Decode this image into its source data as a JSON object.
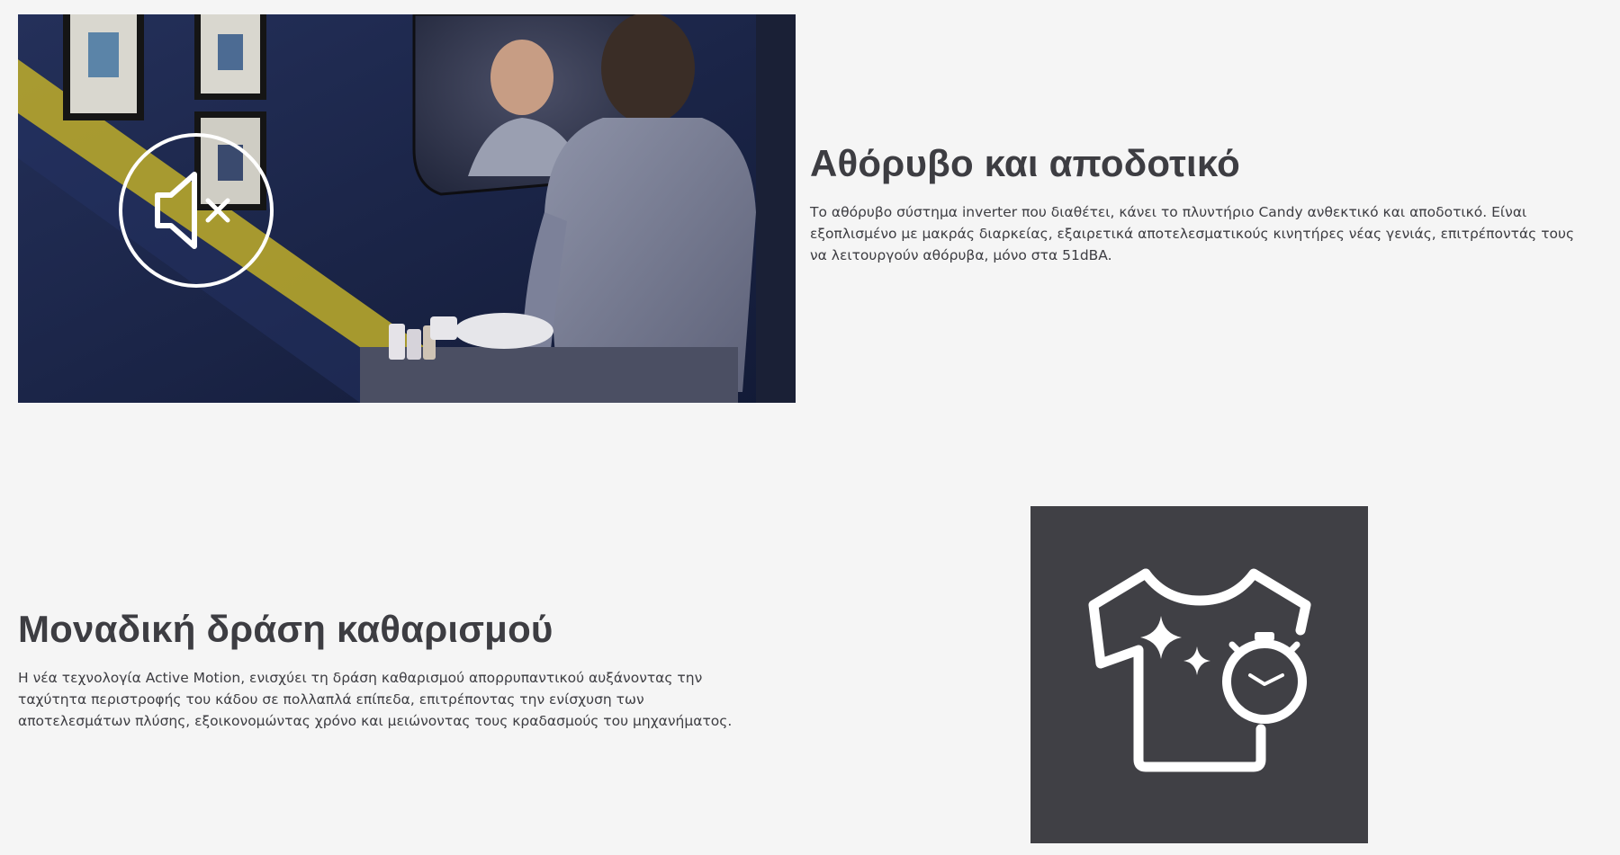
{
  "features": [
    {
      "title": "Αθόρυβο και αποδοτικό",
      "description": "Το αθόρυβο σύστημα inverter που διαθέτει, κάνει το πλυντήριο Candy ανθεκτικό και αποδοτικό. Είναι εξοπλισμένο με μακράς διαρκείας, εξαιρετικά αποτελεσματικούς κινητήρες νέας γενιάς, επιτρέποντάς τους να λειτουργούν αθόρυβα, μόνο στα 51dBA.",
      "icon": "mute-speaker-icon"
    },
    {
      "title": "Μοναδική δράση καθαρισμού",
      "description": "Η νέα τεχνολογία Active Motion, ενισχύει τη δράση καθαρισμού απορρυπαντικού αυξάνοντας την ταχύτητα περιστροφής του κάδου σε πολλαπλά επίπεδα, επιτρέποντας την ενίσχυση των αποτελεσμάτων πλύσης, εξοικονομώντας χρόνο και μειώνοντας τους κραδασμούς του μηχανήματος.",
      "icon": "clean-shirt-timer-icon"
    }
  ],
  "colors": {
    "background": "#f5f5f5",
    "text": "#3d3d42",
    "icon_tile": "#404045",
    "icon_stroke": "#ffffff"
  }
}
